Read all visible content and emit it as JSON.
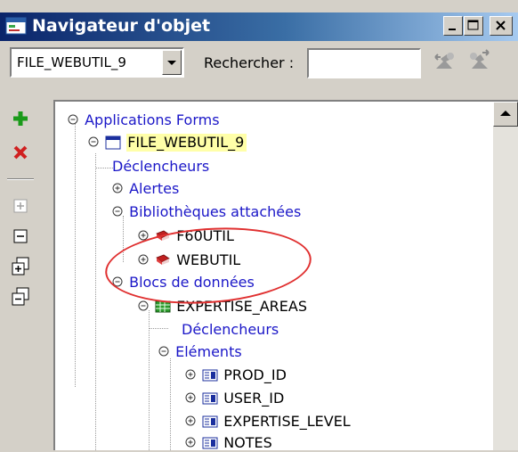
{
  "window": {
    "title": "Navigateur d'objet"
  },
  "toolbar": {
    "module_select_value": "FILE_WEBUTIL_9",
    "search_label": "Rechercher :",
    "search_value": ""
  },
  "tree": {
    "root": "Applications Forms",
    "module": "FILE_WEBUTIL_9",
    "triggers": "Déclencheurs",
    "alerts": "Alertes",
    "attached_libraries": "Bibliothèques attachées",
    "lib1": "F60UTIL",
    "lib2": "WEBUTIL",
    "data_blocks": "Blocs de données",
    "block1": "EXPERTISE_AREAS",
    "block_triggers": "Déclencheurs",
    "items": "Eléments",
    "item1": "PROD_ID",
    "item2": "USER_ID",
    "item3": "EXPERTISE_LEVEL",
    "item4": "NOTES"
  },
  "colors": {
    "link_text": "#1b17c8",
    "highlight": "#ffffa8",
    "annotation": "#e03030",
    "title_start": "#0a246a"
  }
}
